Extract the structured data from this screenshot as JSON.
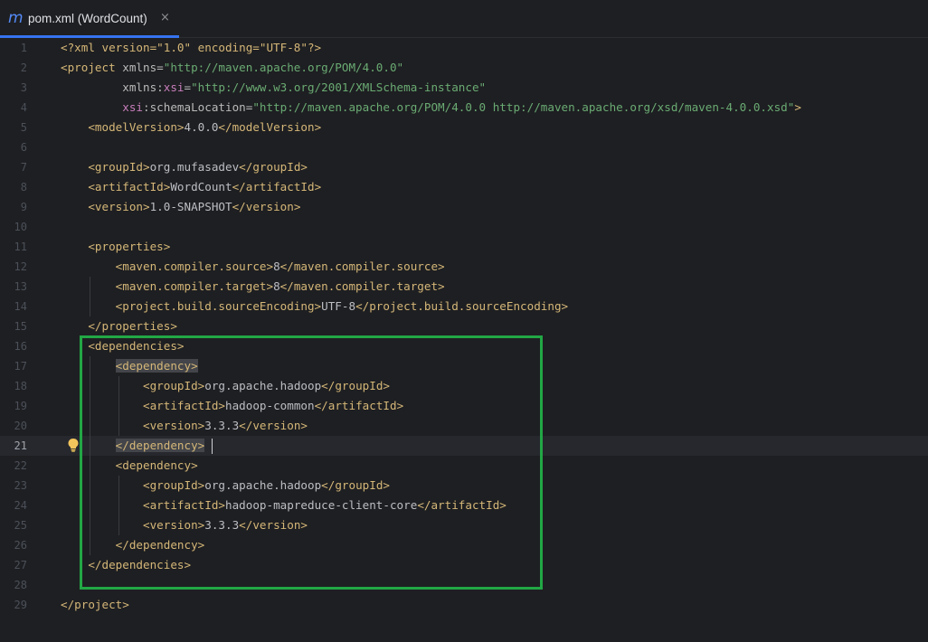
{
  "tab": {
    "icon": "maven-m-icon",
    "icon_glyph": "m",
    "label": "pom.xml (WordCount)",
    "close_glyph": "×"
  },
  "editor": {
    "current_line": 21,
    "lines": [
      [
        [
          "t",
          "<?xml version=\"1.0\" encoding=\"UTF-8\"?>"
        ]
      ],
      [
        [
          "t",
          "<project "
        ],
        [
          "a",
          "xmlns="
        ],
        [
          "s",
          "\"http://maven.apache.org/POM/4.0.0\""
        ]
      ],
      [
        [
          "txt",
          "         "
        ],
        [
          "a",
          "xmlns:"
        ],
        [
          "ns",
          "xsi"
        ],
        [
          "a",
          "="
        ],
        [
          "s",
          "\"http://www.w3.org/2001/XMLSchema-instance\""
        ]
      ],
      [
        [
          "txt",
          "         "
        ],
        [
          "ns",
          "xsi"
        ],
        [
          "a",
          ":schemaLocation="
        ],
        [
          "s",
          "\"http://maven.apache.org/POM/4.0.0 http://maven.apache.org/xsd/maven-4.0.0.xsd\""
        ],
        [
          "t",
          ">"
        ]
      ],
      [
        [
          "txt",
          "    "
        ],
        [
          "t",
          "<modelVersion>"
        ],
        [
          "txt",
          "4.0.0"
        ],
        [
          "t",
          "</modelVersion>"
        ]
      ],
      [],
      [
        [
          "txt",
          "    "
        ],
        [
          "t",
          "<groupId>"
        ],
        [
          "txt",
          "org.mufasadev"
        ],
        [
          "t",
          "</groupId>"
        ]
      ],
      [
        [
          "txt",
          "    "
        ],
        [
          "t",
          "<artifactId>"
        ],
        [
          "txt",
          "WordCount"
        ],
        [
          "t",
          "</artifactId>"
        ]
      ],
      [
        [
          "txt",
          "    "
        ],
        [
          "t",
          "<version>"
        ],
        [
          "txt",
          "1.0-SNAPSHOT"
        ],
        [
          "t",
          "</version>"
        ]
      ],
      [],
      [
        [
          "txt",
          "    "
        ],
        [
          "t",
          "<properties>"
        ]
      ],
      [
        [
          "txt",
          "        "
        ],
        [
          "t",
          "<maven.compiler.source>"
        ],
        [
          "txt",
          "8"
        ],
        [
          "t",
          "</maven.compiler.source>"
        ]
      ],
      [
        [
          "txt",
          "        "
        ],
        [
          "t",
          "<maven.compiler.target>"
        ],
        [
          "txt",
          "8"
        ],
        [
          "t",
          "</maven.compiler.target>"
        ]
      ],
      [
        [
          "txt",
          "        "
        ],
        [
          "t",
          "<project.build.sourceEncoding>"
        ],
        [
          "txt",
          "UTF-8"
        ],
        [
          "t",
          "</project.build.sourceEncoding>"
        ]
      ],
      [
        [
          "txt",
          "    "
        ],
        [
          "t",
          "</properties>"
        ]
      ],
      [
        [
          "txt",
          "    "
        ],
        [
          "t",
          "<dependencies>"
        ]
      ],
      [
        [
          "txt",
          "        "
        ],
        [
          "hl",
          "<dependency>"
        ]
      ],
      [
        [
          "txt",
          "            "
        ],
        [
          "t",
          "<groupId>"
        ],
        [
          "txt",
          "org.apache.hadoop"
        ],
        [
          "t",
          "</groupId>"
        ]
      ],
      [
        [
          "txt",
          "            "
        ],
        [
          "t",
          "<artifactId>"
        ],
        [
          "txt",
          "hadoop-common"
        ],
        [
          "t",
          "</artifactId>"
        ]
      ],
      [
        [
          "txt",
          "            "
        ],
        [
          "t",
          "<version>"
        ],
        [
          "txt",
          "3.3.3"
        ],
        [
          "t",
          "</version>"
        ]
      ],
      [
        [
          "txt",
          "        "
        ],
        [
          "hl",
          "</dependency>"
        ]
      ],
      [
        [
          "txt",
          "        "
        ],
        [
          "t",
          "<dependency>"
        ]
      ],
      [
        [
          "txt",
          "            "
        ],
        [
          "t",
          "<groupId>"
        ],
        [
          "txt",
          "org.apache.hadoop"
        ],
        [
          "t",
          "</groupId>"
        ]
      ],
      [
        [
          "txt",
          "            "
        ],
        [
          "t",
          "<artifactId>"
        ],
        [
          "txt",
          "hadoop-mapreduce-client-core"
        ],
        [
          "t",
          "</artifactId>"
        ]
      ],
      [
        [
          "txt",
          "            "
        ],
        [
          "t",
          "<version>"
        ],
        [
          "txt",
          "3.3.3"
        ],
        [
          "t",
          "</version>"
        ]
      ],
      [
        [
          "txt",
          "        "
        ],
        [
          "t",
          "</dependency>"
        ]
      ],
      [
        [
          "txt",
          "    "
        ],
        [
          "t",
          "</dependencies>"
        ]
      ],
      [],
      [
        [
          "t",
          "</project>"
        ]
      ]
    ]
  },
  "annotation": {
    "highlight_color": "#22a745"
  }
}
